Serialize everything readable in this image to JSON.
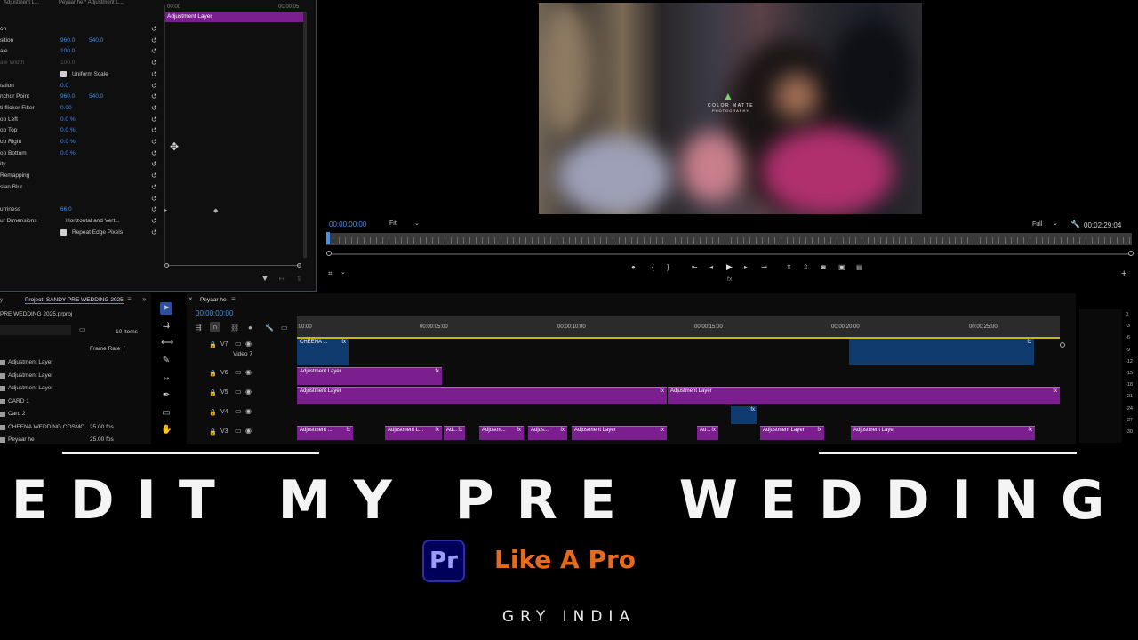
{
  "effect_controls": {
    "tabs": [
      "Adjustment L...",
      "Peyaar he * Adjustment L..."
    ],
    "time_start": "00:00",
    "time_end": "00:00:05",
    "clip_label": "Adjustment Layer",
    "rows": [
      {
        "label": "on"
      },
      {
        "label": "sition",
        "v1": "960.0",
        "v2": "540.0"
      },
      {
        "label": "ale",
        "v1": "100.0"
      },
      {
        "label": "ale Width",
        "v1": "100.0",
        "dim": true
      },
      {
        "label": "",
        "checkbox": "Uniform Scale"
      },
      {
        "label": "tation",
        "v1": "0.0"
      },
      {
        "label": "nchor Point",
        "v1": "960.0",
        "v2": "540.0"
      },
      {
        "label": "ti-flicker Filter",
        "v1": "0.00"
      },
      {
        "label": "op Left",
        "v1": "0.0 %"
      },
      {
        "label": "op Top",
        "v1": "0.0 %"
      },
      {
        "label": "op Right",
        "v1": "0.0 %"
      },
      {
        "label": "op Bottom",
        "v1": "0.0 %"
      },
      {
        "label": "ity"
      },
      {
        "label": "Remapping"
      },
      {
        "label": "sian Blur"
      },
      {
        "label": ""
      },
      {
        "label": "urriness",
        "v1": "66.0"
      },
      {
        "label": "ur Dimensions",
        "dropdown": "Horizontal and Vert..."
      },
      {
        "label": "",
        "checkbox": "Repeat Edge Pixels"
      }
    ]
  },
  "program_monitor": {
    "timecode": "00:00:00:00",
    "fit": "Fit",
    "quality": "Full",
    "duration": "00:02:29:04",
    "watermark_line1": "COLOR MATTE",
    "watermark_line2": "PHOTOGRAPHY"
  },
  "project_panel": {
    "tab_prev": "y",
    "title": "Project: SANDY PRE WEDDING 2025",
    "file": "PRE WEDDING 2025.prproj",
    "count": "10 Items",
    "col_frame_rate": "Frame Rate",
    "items": [
      {
        "name": "Adjustment Layer",
        "fps": ""
      },
      {
        "name": "Adjustment Layer",
        "fps": ""
      },
      {
        "name": "Adjustment Layer",
        "fps": ""
      },
      {
        "name": "CARD 1",
        "fps": ""
      },
      {
        "name": "Card 2",
        "fps": ""
      },
      {
        "name": "CHEENA WEDDING COSMO...",
        "fps": "25.00 fps"
      },
      {
        "name": "Peyaar he",
        "fps": "25.00 fps"
      }
    ]
  },
  "timeline": {
    "sequence": "Peyaar he",
    "timecode": "00:00:00:00",
    "ruler_labels": [
      ":00:00",
      "00:00:05:00",
      "00:00:10:00",
      "00:00:15:00",
      "00:00:20:00",
      "00:00:25:00"
    ],
    "tracks": [
      "V7",
      "V6",
      "V5",
      "V4",
      "V3"
    ],
    "track_v7_name": "Video 7",
    "clips": {
      "v7_a": "CHEENA ...",
      "v6_a": "Adjustment Layer",
      "v5_a": "Adjustment Layer",
      "v5_b": "Adjustment Layer",
      "v3_a": "Adjustment ...",
      "v3_b": "Adjustment L...",
      "v3_c": "Ad...",
      "v3_d": "Adjustm...",
      "v3_e": "Adjus...",
      "v3_f": "Adjustment Layer",
      "v3_g": "Ad...",
      "v3_h": "Adjustment Layer",
      "v3_i": "Adjustment Layer"
    },
    "fx": "fx",
    "vu_labels": [
      "0",
      "-3",
      "-6",
      "-9",
      "-12",
      "-15",
      "-18",
      "-21",
      "-24",
      "-27",
      "-30"
    ]
  },
  "overlay": {
    "headline": "EDIT MY PRE WEDDING",
    "pr_logo": "Pr",
    "subtitle": "Like A Pro",
    "brand": "GRY INDIA"
  },
  "colors": {
    "clip_purple": "#7b1f8f",
    "clip_blue": "#0f3a6e",
    "accent": "#e66a1c",
    "timecode_blue": "#4a8fe8"
  }
}
